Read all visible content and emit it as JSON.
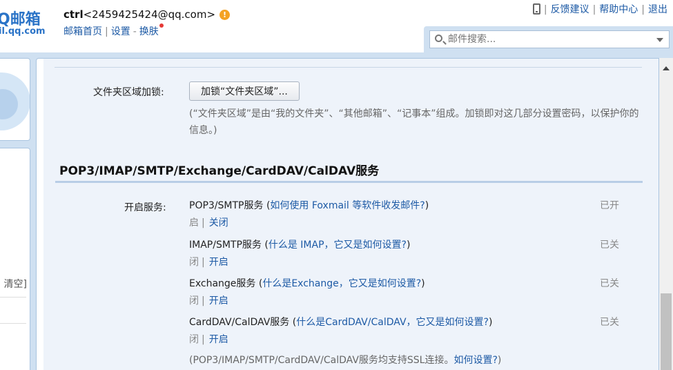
{
  "header": {
    "logo_text": "Q邮箱",
    "logo_domain": "il.qq.com",
    "username": "ctrl",
    "email": "<2459425424@qq.com>",
    "warn_icon": "!",
    "links": {
      "home": "邮箱首页",
      "settings": "设置",
      "dash": "-",
      "skin": "换肤"
    },
    "top_right": {
      "feedback": "反馈建议",
      "help": "帮助中心",
      "logout": "退出"
    }
  },
  "search": {
    "placeholder": "邮件搜索..."
  },
  "sidebar": {
    "clear_label": "清空]"
  },
  "settings": {
    "folder_lock_label": "文件夹区域加锁:",
    "folder_lock_button": "加锁“文件夹区域”...",
    "folder_lock_desc": "(“文件夹区域”是由“我的文件夹”、“其他邮箱”、“记事本”组成。加锁即对这几部分设置密码，以保护你的信息。)",
    "section_title": "POP3/IMAP/SMTP/Exchange/CardDAV/CalDAV服务",
    "open_service_label": "开启服务:",
    "services": [
      {
        "name": "POP3/SMTP服务 (",
        "help": "如何使用 Foxmail 等软件收发邮件?",
        "close": ")",
        "status_a": "已开",
        "status_b": "启",
        "action": "关闭"
      },
      {
        "name": "IMAP/SMTP服务 (",
        "help": "什么是 IMAP，它又是如何设置?",
        "close": ")",
        "status_a": "已关",
        "status_b": "闭",
        "action": "开启"
      },
      {
        "name": "Exchange服务 (",
        "help": "什么是Exchange，它又是如何设置?",
        "close": ")",
        "status_a": "已关",
        "status_b": "闭",
        "action": "开启"
      },
      {
        "name": "CardDAV/CalDAV服务 (",
        "help": "什么是CardDAV/CalDAV，它又是如何设置?",
        "close": ")",
        "status_a": "已关",
        "status_b": "闭",
        "action": "开启"
      }
    ],
    "ssl_note": "(POP3/IMAP/SMTP/CardDAV/CalDAV服务均支持SSL连接。",
    "ssl_link": "如何设置?",
    "ssl_close": ")"
  },
  "icons": [
    "phone-icon",
    "warning-icon",
    "search-icon",
    "dropdown-caret-icon",
    "scroll-up-icon"
  ]
}
